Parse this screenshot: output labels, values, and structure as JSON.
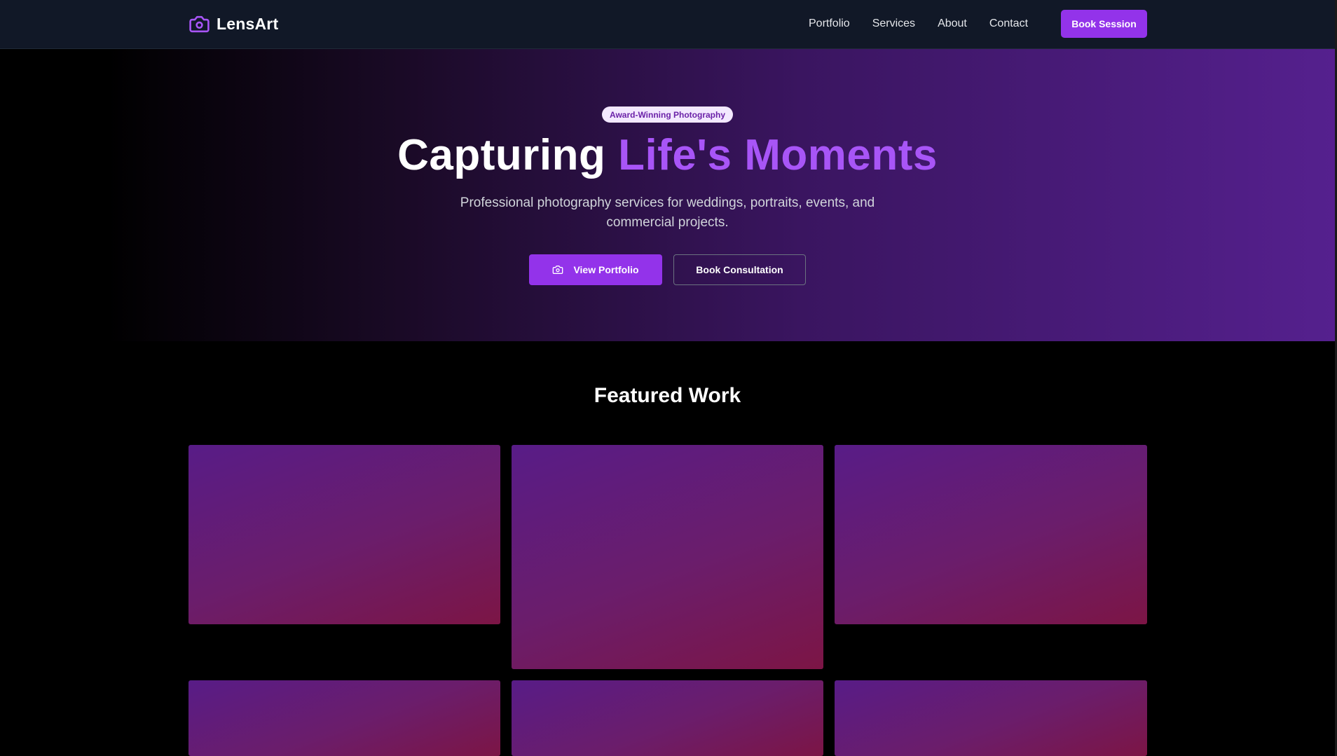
{
  "nav": {
    "brand": "LensArt",
    "links": [
      "Portfolio",
      "Services",
      "About",
      "Contact"
    ],
    "cta": "Book Session"
  },
  "hero": {
    "badge": "Award-Winning Photography",
    "title_plain": "Capturing ",
    "title_accent": "Life's Moments",
    "subtitle_line1": "Professional photography services for weddings, portraits, events, and",
    "subtitle_line2": "commercial projects.",
    "primary_button": "View Portfolio",
    "secondary_button": "Book Consultation"
  },
  "featured": {
    "title": "Featured Work"
  },
  "icons": {
    "brand": "camera-icon",
    "primary_button": "camera-icon"
  },
  "colors": {
    "accent": "#9333ea",
    "accent_text": "#a855f7",
    "nav_bg": "#111827",
    "badge_bg": "#f3e8ff",
    "badge_text": "#6b21a8"
  }
}
